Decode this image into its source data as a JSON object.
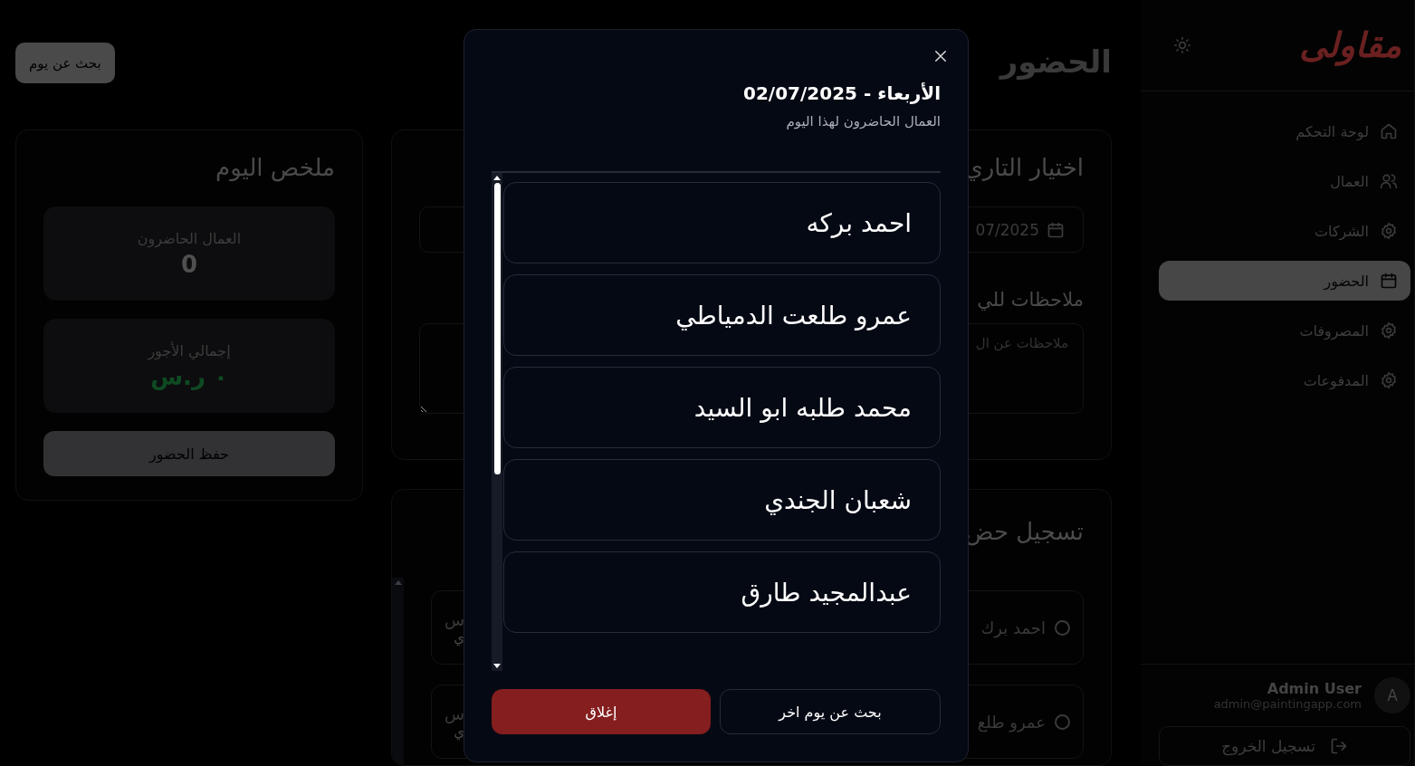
{
  "sidebar": {
    "logo": "مقاولى",
    "nav": [
      {
        "label": "لوحة التحكم",
        "kind": "home",
        "selected": false
      },
      {
        "label": "العمال",
        "kind": "users",
        "selected": false
      },
      {
        "label": "الشركات",
        "kind": "gear",
        "selected": false
      },
      {
        "label": "الحضور",
        "kind": "calendar",
        "selected": true
      },
      {
        "label": "المصروفات",
        "kind": "gear",
        "selected": false
      },
      {
        "label": "المدفوعات",
        "kind": "gear",
        "selected": false
      }
    ],
    "user": {
      "name": "Admin User",
      "email": "admin@paintingapp.com",
      "avatar": "A"
    },
    "logout": "تسجيل الخروج"
  },
  "header": {
    "title": "الحضور",
    "search_button": "بحث عن يوم"
  },
  "date_card": {
    "title": "اختيار التاري",
    "date_value": "07/2025",
    "notes_title": "ملاحظات للي",
    "notes_placeholder": "ملاحظات عن ال"
  },
  "attendance_card": {
    "title": "تسجيل حض",
    "workers": [
      {
        "name": "احمد برك",
        "wage": "س",
        "detail": "ي",
        "checked": false
      },
      {
        "name": "عمرو طلع",
        "wage": "س",
        "detail": "ي",
        "checked": false
      }
    ]
  },
  "summary": {
    "title": "ملخص اليوم",
    "stats": [
      {
        "label": "العمال الحاضرون",
        "value": "0",
        "kind": "count"
      },
      {
        "label": "إجمالي الأجور",
        "value": "٠ ر.س",
        "kind": "money"
      }
    ],
    "save_button": "حفظ الحضور"
  },
  "modal": {
    "title": "الأربعاء - 02/07/2025",
    "subtitle": "العمال الحاضرون لهذا اليوم",
    "workers": [
      "احمد بركه",
      "عمرو طلعت الدمياطي",
      "محمد طلبه ابو السيد",
      "شعبان الجندي",
      "عبدالمجيد طارق"
    ],
    "close_button": "إغلاق",
    "other_day_button": "بحث عن يوم اخر"
  }
}
